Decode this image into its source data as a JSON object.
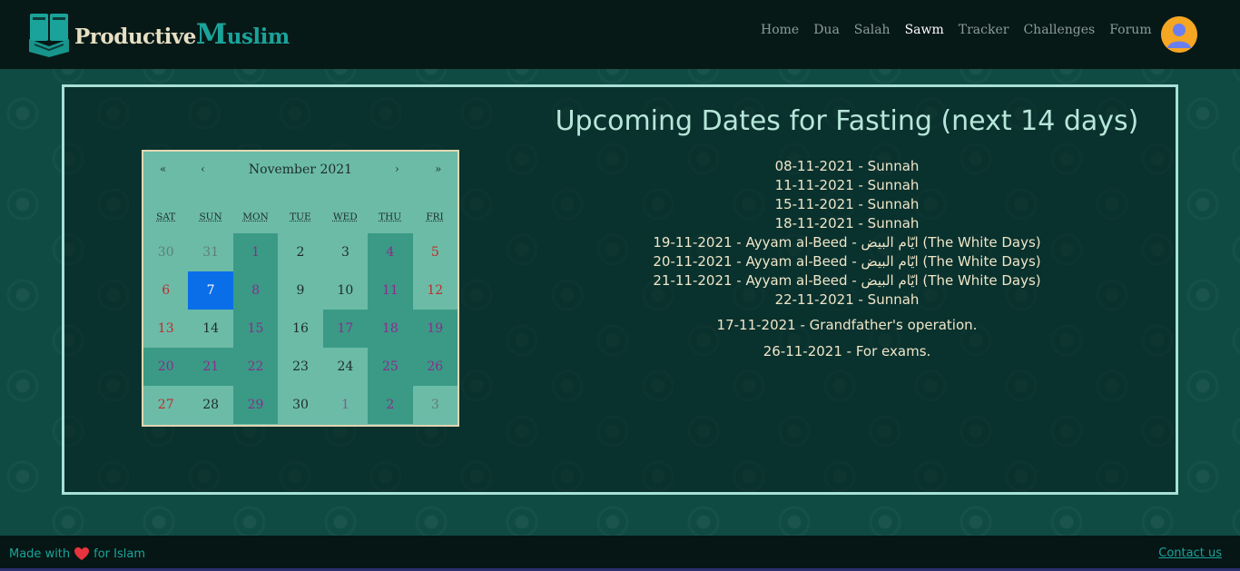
{
  "brand": {
    "part_a": "Productive",
    "part_m": "M",
    "part_b": "uslim"
  },
  "nav": {
    "links": [
      "Home",
      "Dua",
      "Salah",
      "Sawm",
      "Tracker",
      "Challenges",
      "Forum"
    ],
    "active": "Sawm"
  },
  "calendar": {
    "month_label": "November 2021",
    "prev_year": "«",
    "prev_month": "‹",
    "next_month": "›",
    "next_year": "»",
    "weekdays": [
      "SAT",
      "SUN",
      "MON",
      "TUE",
      "WED",
      "THU",
      "FRI"
    ],
    "weeks": [
      [
        "30",
        "31",
        "1",
        "2",
        "3",
        "4",
        "5"
      ],
      [
        "6",
        "7",
        "8",
        "9",
        "10",
        "11",
        "12"
      ],
      [
        "13",
        "14",
        "15",
        "16",
        "17",
        "18",
        "19"
      ],
      [
        "20",
        "21",
        "22",
        "23",
        "24",
        "25",
        "26"
      ],
      [
        "27",
        "28",
        "29",
        "30",
        "1",
        "2",
        "3"
      ]
    ],
    "today": "7"
  },
  "listing": {
    "title": "Upcoming Dates for Fasting (next 14 days)",
    "dates": [
      "08-11-2021 - Sunnah",
      "11-11-2021 - Sunnah",
      "15-11-2021 - Sunnah",
      "18-11-2021 - Sunnah",
      "19-11-2021 - Ayyam al-Beed - ايّام البيض (The White Days)",
      "20-11-2021 - Ayyam al-Beed - ايّام البيض (The White Days)",
      "21-11-2021 - Ayyam al-Beed - ايّام البيض (The White Days)",
      "22-11-2021 - Sunnah"
    ],
    "events": [
      "17-11-2021 - Grandfather's operation.",
      "26-11-2021 - For exams."
    ]
  },
  "footer": {
    "made_with": "Made with",
    "for_islam": "for Islam",
    "contact": "Contact us"
  },
  "colors": {
    "page_background": "#0f4a43",
    "navbar": "#071917",
    "accent_teal": "#1aa39a",
    "panel_border": "#a7e0d6",
    "calendar_background": "#6cbba7",
    "fasting_day": "#3a9a85",
    "today": "#0a6ee8",
    "heart": "#e8343f",
    "avatar": "#f5a623"
  },
  "icons": [
    "book-logo-icon",
    "user-avatar-icon",
    "heart-icon"
  ]
}
